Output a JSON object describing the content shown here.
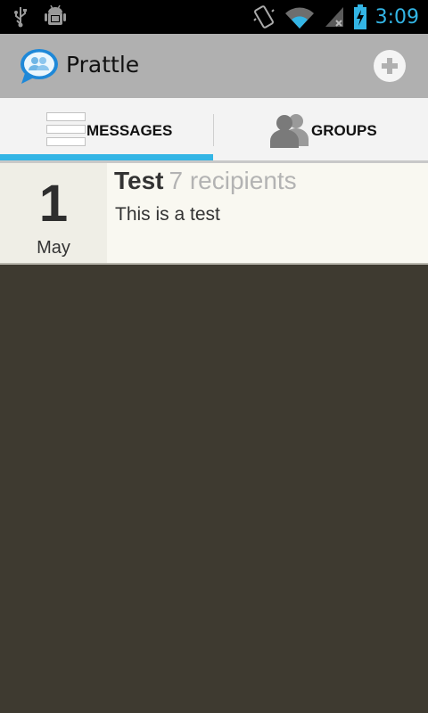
{
  "status_bar": {
    "time": "3:09",
    "icons": [
      "usb-icon",
      "android-debug-icon",
      "vibrate-icon",
      "wifi-icon",
      "no-signal-icon",
      "battery-charging-icon"
    ],
    "accent_color": "#33b5e5"
  },
  "action_bar": {
    "title": "Prattle",
    "logo_icon": "chat-bubble-people-icon",
    "add_icon": "plus-circle-icon"
  },
  "tabs": [
    {
      "label": "MESSAGES",
      "icon": "list-icon",
      "selected": true
    },
    {
      "label": "GROUPS",
      "icon": "people-icon",
      "selected": false
    }
  ],
  "messages": [
    {
      "day": "1",
      "month": "May",
      "title": "Test",
      "recipients": "7 recipients",
      "body": "This is a test"
    }
  ],
  "colors": {
    "background": "#3e3a30",
    "action_bar": "#b0b0b0",
    "tab_indicator": "#33b5e5",
    "list_item_bg": "#f9f8f1"
  }
}
